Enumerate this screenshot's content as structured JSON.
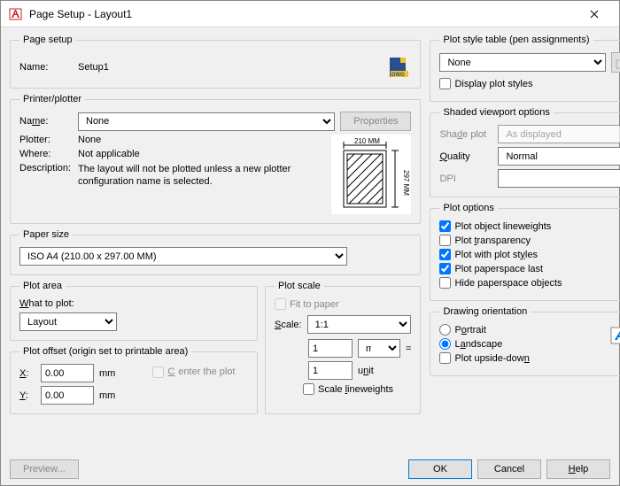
{
  "title": "Page Setup - Layout1",
  "pageSetup": {
    "legend": "Page setup",
    "nameLabel": "Name:",
    "name": "Setup1"
  },
  "printer": {
    "legend": "Printer/plotter",
    "nameLabel": "Name:",
    "nameValue": "None",
    "propertiesBtn": "Properties",
    "plotterLabel": "Plotter:",
    "plotterValue": "None",
    "whereLabel": "Where:",
    "whereValue": "Not applicable",
    "descLabel": "Description:",
    "descValue": "The layout will not be plotted unless a new plotter configuration name is selected.",
    "preview": {
      "width": "210 MM",
      "height": "297 MM"
    }
  },
  "paperSize": {
    "legend": "Paper size",
    "value": "ISO A4 (210.00 x 297.00 MM)"
  },
  "plotArea": {
    "legend": "Plot area",
    "whatLabel": "What to plot:",
    "value": "Layout"
  },
  "plotScale": {
    "legend": "Plot scale",
    "fitLabel": "Fit to paper",
    "scaleLabel": "Scale:",
    "scaleValue": "1:1",
    "topValue": "1",
    "unit": "mm",
    "equals": "=",
    "bottomValue": "1",
    "unitLabel": "unit",
    "scaleLineweights": "Scale lineweights"
  },
  "plotOffset": {
    "legend": "Plot offset (origin set to printable area)",
    "xLabel": "X:",
    "xValue": "0.00",
    "xUnit": "mm",
    "centerLabel": "Center the plot",
    "yLabel": "Y:",
    "yValue": "0.00",
    "yUnit": "mm"
  },
  "plotStyle": {
    "legend": "Plot style table (pen assignments)",
    "value": "None",
    "displayLabel": "Display plot styles"
  },
  "shaded": {
    "legend": "Shaded viewport options",
    "shadeLabel": "Shade plot",
    "shadeValue": "As displayed",
    "qualityLabel": "Quality",
    "qualityValue": "Normal",
    "dpiLabel": "DPI",
    "dpiValue": ""
  },
  "plotOptions": {
    "legend": "Plot options",
    "lineweights": "Plot object lineweights",
    "transparency": "Plot transparency",
    "plotstyles": "Plot with plot styles",
    "paperspaceLast": "Plot paperspace last",
    "hidePaperspace": "Hide paperspace objects"
  },
  "orientation": {
    "legend": "Drawing orientation",
    "portrait": "Portrait",
    "landscape": "Landscape",
    "upsideDown": "Plot upside-down"
  },
  "footer": {
    "preview": "Preview...",
    "ok": "OK",
    "cancel": "Cancel",
    "help": "Help"
  }
}
